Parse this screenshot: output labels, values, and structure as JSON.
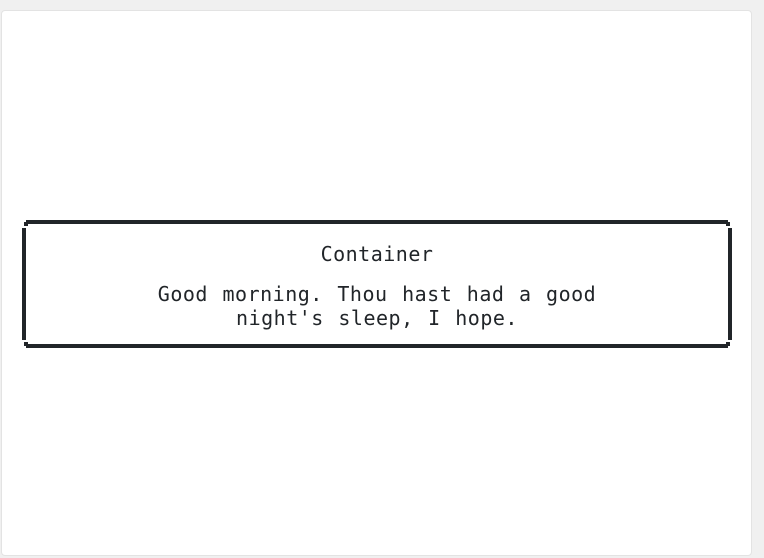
{
  "container": {
    "title": "Container",
    "line1": "Good morning. Thou hast had a good",
    "line2": "night's sleep, I hope."
  },
  "colors": {
    "page_background": "#f0f0f0",
    "card_background": "#ffffff",
    "border": "#212529",
    "text": "#212529"
  }
}
